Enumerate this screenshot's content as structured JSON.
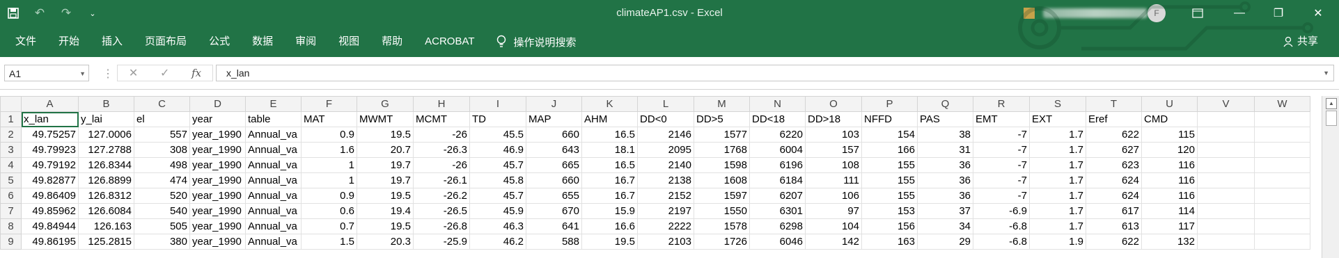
{
  "window": {
    "title": "climateAP1.csv  -  Excel",
    "avatar_initial": "F"
  },
  "colors": {
    "excel_green": "#217346",
    "grid_line": "#e1e1e1",
    "header_bg": "#f3f3f3"
  },
  "qat": {
    "icons": [
      "save-icon",
      "undo-icon",
      "redo-icon",
      "customize-qat-icon"
    ]
  },
  "menu": {
    "items": [
      "文件",
      "开始",
      "插入",
      "页面布局",
      "公式",
      "数据",
      "审阅",
      "视图",
      "帮助",
      "ACROBAT"
    ],
    "tell_me": "操作说明搜索",
    "share": "共享"
  },
  "formula_bar": {
    "name_box": "A1",
    "content": "x_lan"
  },
  "sheet": {
    "columns": [
      "A",
      "B",
      "C",
      "D",
      "E",
      "F",
      "G",
      "H",
      "I",
      "J",
      "K",
      "L",
      "M",
      "N",
      "O",
      "P",
      "Q",
      "R",
      "S",
      "T",
      "U",
      "V",
      "W"
    ],
    "row_numbers": [
      "1",
      "2",
      "3",
      "4",
      "5",
      "6",
      "7",
      "8",
      "9"
    ],
    "header_row": [
      "x_lan",
      "y_lai",
      "el",
      "year",
      "table",
      "MAT",
      "MWMT",
      "MCMT",
      "TD",
      "MAP",
      "AHM",
      "DD<0",
      "DD>5",
      "DD<18",
      "DD>18",
      "NFFD",
      "PAS",
      "EMT",
      "EXT",
      "Eref",
      "CMD",
      "",
      ""
    ],
    "rows": [
      [
        "49.75257",
        "127.0006",
        "557",
        "year_1990",
        "Annual_va",
        "0.9",
        "19.5",
        "-26",
        "45.5",
        "660",
        "16.5",
        "2146",
        "1577",
        "6220",
        "103",
        "154",
        "38",
        "-7",
        "1.7",
        "622",
        "115",
        "",
        ""
      ],
      [
        "49.79923",
        "127.2788",
        "308",
        "year_1990",
        "Annual_va",
        "1.6",
        "20.7",
        "-26.3",
        "46.9",
        "643",
        "18.1",
        "2095",
        "1768",
        "6004",
        "157",
        "166",
        "31",
        "-7",
        "1.7",
        "627",
        "120",
        "",
        ""
      ],
      [
        "49.79192",
        "126.8344",
        "498",
        "year_1990",
        "Annual_va",
        "1",
        "19.7",
        "-26",
        "45.7",
        "665",
        "16.5",
        "2140",
        "1598",
        "6196",
        "108",
        "155",
        "36",
        "-7",
        "1.7",
        "623",
        "116",
        "",
        ""
      ],
      [
        "49.82877",
        "126.8899",
        "474",
        "year_1990",
        "Annual_va",
        "1",
        "19.7",
        "-26.1",
        "45.8",
        "660",
        "16.7",
        "2138",
        "1608",
        "6184",
        "111",
        "155",
        "36",
        "-7",
        "1.7",
        "624",
        "116",
        "",
        ""
      ],
      [
        "49.86409",
        "126.8312",
        "520",
        "year_1990",
        "Annual_va",
        "0.9",
        "19.5",
        "-26.2",
        "45.7",
        "655",
        "16.7",
        "2152",
        "1597",
        "6207",
        "106",
        "155",
        "36",
        "-7",
        "1.7",
        "624",
        "116",
        "",
        ""
      ],
      [
        "49.85962",
        "126.6084",
        "540",
        "year_1990",
        "Annual_va",
        "0.6",
        "19.4",
        "-26.5",
        "45.9",
        "670",
        "15.9",
        "2197",
        "1550",
        "6301",
        "97",
        "153",
        "37",
        "-6.9",
        "1.7",
        "617",
        "114",
        "",
        ""
      ],
      [
        "49.84944",
        "126.163",
        "505",
        "year_1990",
        "Annual_va",
        "0.7",
        "19.5",
        "-26.8",
        "46.3",
        "641",
        "16.6",
        "2222",
        "1578",
        "6298",
        "104",
        "156",
        "34",
        "-6.8",
        "1.7",
        "613",
        "117",
        "",
        ""
      ],
      [
        "49.86195",
        "125.2815",
        "380",
        "year_1990",
        "Annual_va",
        "1.5",
        "20.3",
        "-25.9",
        "46.2",
        "588",
        "19.5",
        "2103",
        "1726",
        "6046",
        "142",
        "163",
        "29",
        "-6.8",
        "1.9",
        "622",
        "132",
        "",
        ""
      ]
    ]
  }
}
